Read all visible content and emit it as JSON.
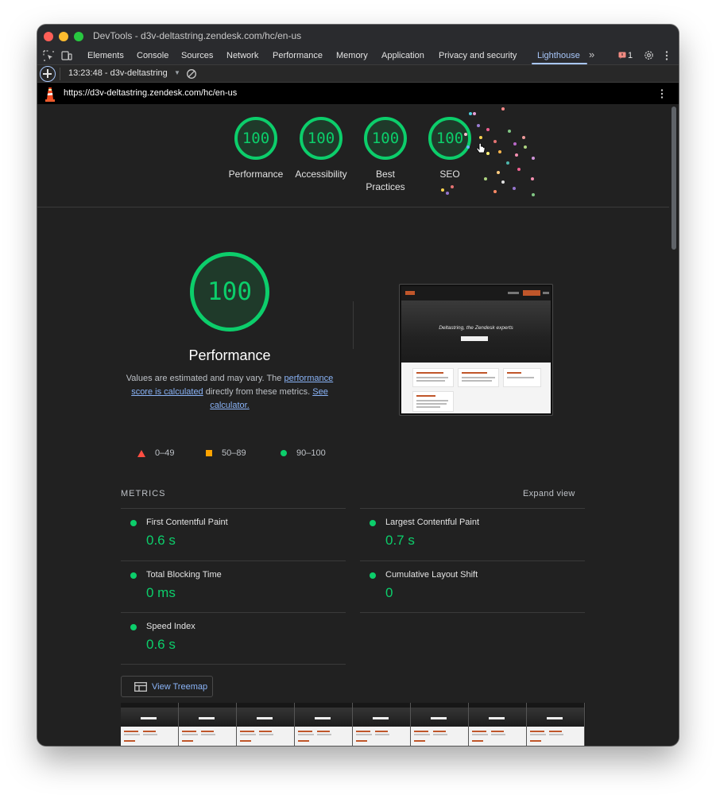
{
  "window": {
    "title": "DevTools - d3v-deltastring.zendesk.com/hc/en-us"
  },
  "devtools_tabs": [
    {
      "label": "Elements"
    },
    {
      "label": "Console"
    },
    {
      "label": "Sources"
    },
    {
      "label": "Network"
    },
    {
      "label": "Performance"
    },
    {
      "label": "Memory"
    },
    {
      "label": "Application"
    },
    {
      "label": "Privacy and security"
    },
    {
      "label": "Lighthouse",
      "active": true
    }
  ],
  "more_tabs_glyph": "»",
  "issues_count": "1",
  "lighthouse_toolbar": {
    "report_selector": "13:23:48 - d3v-deltastring"
  },
  "url": "https://d3v-deltastring.zendesk.com/hc/en-us",
  "summary_gauges": [
    {
      "score": "100",
      "label": "Performance"
    },
    {
      "score": "100",
      "label": "Accessibility"
    },
    {
      "score": "100",
      "label": "Best Practices"
    },
    {
      "score": "100",
      "label": "SEO"
    }
  ],
  "performance": {
    "score": "100",
    "title": "Performance",
    "desc_prefix": "Values are estimated and may vary. The ",
    "desc_link1": "performance score is calculated",
    "desc_mid": " directly from these metrics. ",
    "desc_link2": "See calculator."
  },
  "legend": [
    {
      "range": "0–49",
      "shape": "triangle",
      "color": "#ff4e42"
    },
    {
      "range": "50–89",
      "shape": "square",
      "color": "#ffa400"
    },
    {
      "range": "90–100",
      "shape": "circle",
      "color": "#0cce6b"
    }
  ],
  "screenshot": {
    "hero_text": "Deltastring, the Zendesk experts"
  },
  "metrics": {
    "header": "METRICS",
    "expand_label": "Expand view",
    "items": [
      {
        "name": "First Contentful Paint",
        "value": "0.6 s"
      },
      {
        "name": "Largest Contentful Paint",
        "value": "0.7 s"
      },
      {
        "name": "Total Blocking Time",
        "value": "0 ms"
      },
      {
        "name": "Cumulative Layout Shift",
        "value": "0"
      },
      {
        "name": "Speed Index",
        "value": "0.6 s"
      }
    ]
  },
  "treemap_button": "View Treemap",
  "colors": {
    "pass": "#0cce6b",
    "average": "#ffa400",
    "fail": "#ff4e42",
    "link": "#8ab4f8",
    "active_tab": "#a8c7fa"
  }
}
